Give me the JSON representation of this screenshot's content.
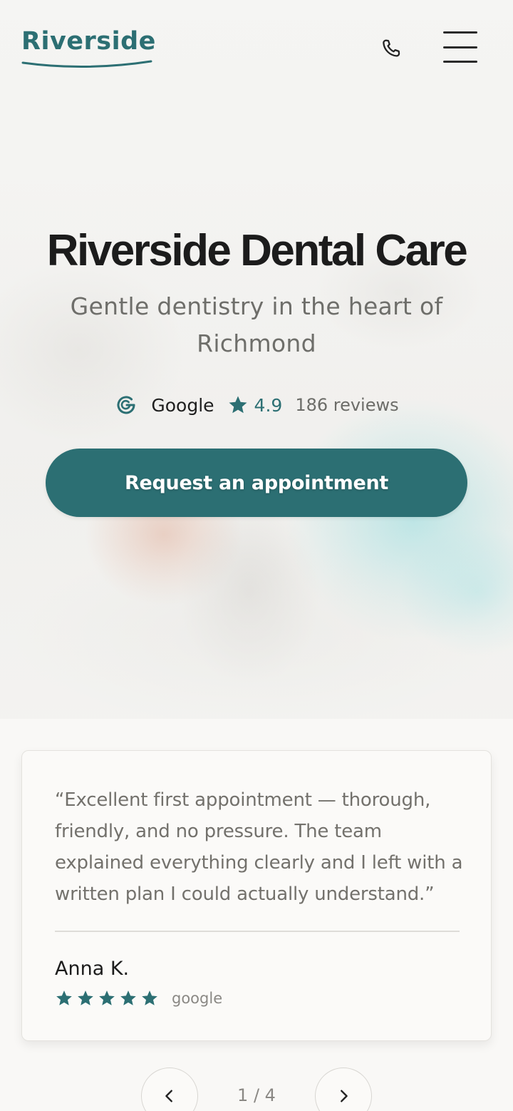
{
  "header": {
    "logo": "Riverside",
    "phone_icon": "phone-icon",
    "menu_icon": "hamburger-menu-icon"
  },
  "hero": {
    "title": "Riverside Dental Care",
    "subtitle": "Gentle dentistry in the heart of Richmond",
    "rating": {
      "provider_icon": "google-icon",
      "provider": "Google",
      "star_icon": "star-icon",
      "score": "4.9",
      "reviews": "186 reviews"
    },
    "cta_label": "Request an appointment"
  },
  "review": {
    "quote": "“Excellent first appointment — thorough, friendly, and no pressure. The team explained everything clearly and I left with a written plan I could actually understand.”",
    "author": "Anna K.",
    "stars": 5,
    "source": "google"
  },
  "pager": {
    "prev_icon": "chevron-left-icon",
    "next_icon": "chevron-right-icon",
    "label": "1 / 4"
  },
  "colors": {
    "brand": "#2c6f73",
    "text": "#1c1c1c",
    "muted": "#6e6e6a",
    "background": "#f9f8f6"
  }
}
